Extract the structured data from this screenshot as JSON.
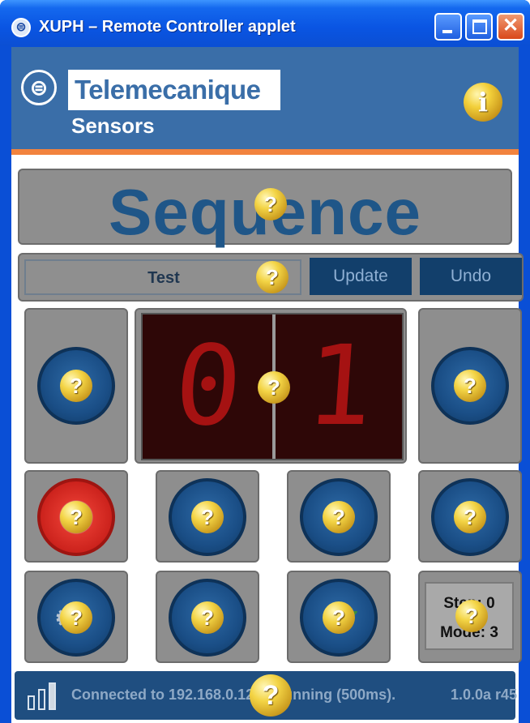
{
  "window": {
    "title": "XUPH – Remote Controller applet",
    "app_icon": "applet-icon",
    "controls": {
      "minimize": "minimize-icon",
      "maximize": "maximize-icon",
      "close_glyph": "✕"
    }
  },
  "header": {
    "brand": "Telemecanique",
    "subbrand": "Sensors",
    "info_glyph": "i"
  },
  "sequence": {
    "title": "Sequence"
  },
  "program_bar": {
    "name_value": "Test",
    "update_label": "Update",
    "undo_label": "Undo"
  },
  "display": {
    "digits": [
      "0",
      "1"
    ]
  },
  "status_panel": {
    "step_label": "Step: 0",
    "mode_label": "Mode: 3"
  },
  "status_bar": {
    "message": "Connected to 192.168.0.12. Is running (500ms).",
    "version": "1.0.0a r45"
  },
  "help_glyph": "?",
  "colors": {
    "header": "#3a6ea8",
    "stripe": "#f2833e",
    "panel": "#8e8e8e",
    "button_dark": "#123f6b",
    "display_bg": "#2e0707",
    "segment": "#a51212"
  }
}
